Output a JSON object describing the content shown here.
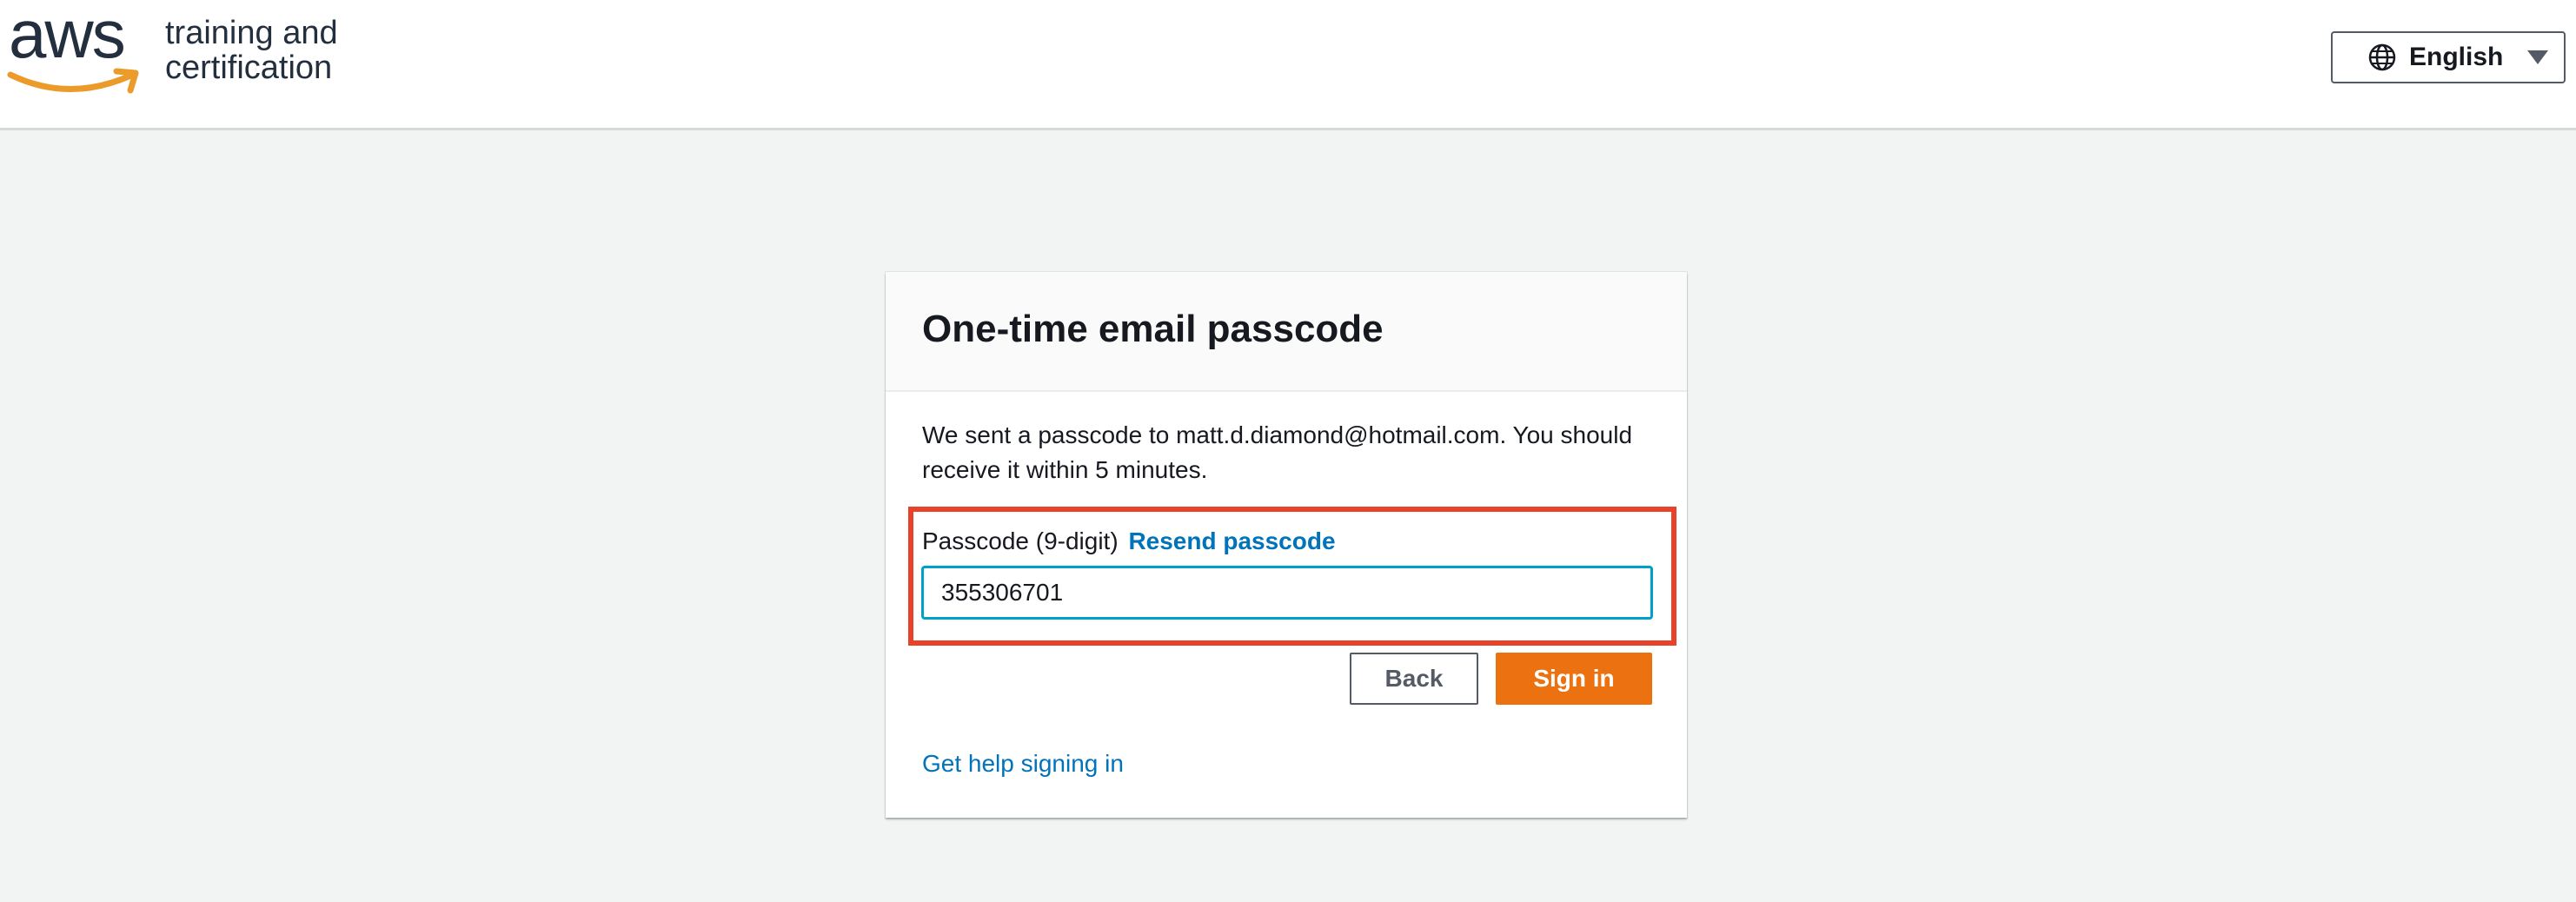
{
  "header": {
    "logo_wordmark": "aws",
    "logo_line1": "training and",
    "logo_line2": "certification",
    "language": {
      "icon": "globe-icon",
      "label": "English",
      "caret_icon": "caret-down-icon"
    }
  },
  "card": {
    "title": "One-time email passcode",
    "message": "We sent a passcode to matt.d.diamond@hotmail.com. You should receive it within 5 minutes.",
    "passcode": {
      "label": "Passcode (9-digit)",
      "resend_label": "Resend passcode",
      "value": "355306701"
    },
    "back_label": "Back",
    "signin_label": "Sign in",
    "help_label": "Get help signing in"
  },
  "colors": {
    "accent_orange": "#ec7211",
    "link_blue": "#0073bb",
    "highlight_red": "#e8432a",
    "input_focus": "#00a1c9",
    "page_background": "#f2f3f3"
  }
}
